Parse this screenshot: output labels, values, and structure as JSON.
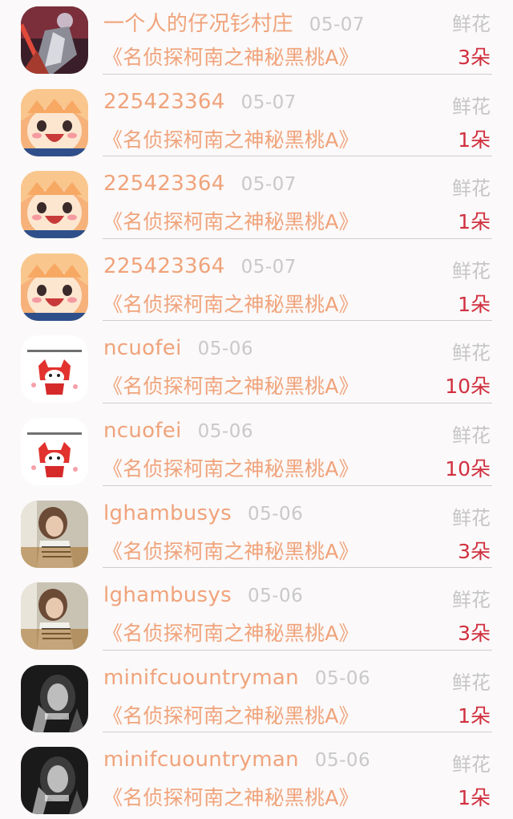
{
  "rows": [
    {
      "username": "一个人的仔况钐村庄",
      "date": "05-07",
      "book": "《名侦探柯南之神秘黑桃A》",
      "gift_type": "鲜花",
      "gift_count": "3朵",
      "avatar": "warrior"
    },
    {
      "username": "225423364",
      "date": "05-07",
      "book": "《名侦探柯南之神秘黑桃A》",
      "gift_type": "鲜花",
      "gift_count": "1朵",
      "avatar": "umaru"
    },
    {
      "username": "225423364",
      "date": "05-07",
      "book": "《名侦探柯南之神秘黑桃A》",
      "gift_type": "鲜花",
      "gift_count": "1朵",
      "avatar": "umaru"
    },
    {
      "username": "225423364",
      "date": "05-07",
      "book": "《名侦探柯南之神秘黑桃A》",
      "gift_type": "鲜花",
      "gift_count": "1朵",
      "avatar": "umaru"
    },
    {
      "username": "ncuofei",
      "date": "05-06",
      "book": "《名侦探柯南之神秘黑桃A》",
      "gift_type": "鲜花",
      "gift_count": "10朵",
      "avatar": "fox"
    },
    {
      "username": "ncuofei",
      "date": "05-06",
      "book": "《名侦探柯南之神秘黑桃A》",
      "gift_type": "鲜花",
      "gift_count": "10朵",
      "avatar": "fox"
    },
    {
      "username": "lghambusys",
      "date": "05-06",
      "book": "《名侦探柯南之神秘黑桃A》",
      "gift_type": "鲜花",
      "gift_count": "3朵",
      "avatar": "girl-photo"
    },
    {
      "username": "lghambusys",
      "date": "05-06",
      "book": "《名侦探柯南之神秘黑桃A》",
      "gift_type": "鲜花",
      "gift_count": "3朵",
      "avatar": "girl-photo"
    },
    {
      "username": "minifcuountryman",
      "date": "05-06",
      "book": "《名侦探柯南之神秘黑桃A》",
      "gift_type": "鲜花",
      "gift_count": "1朵",
      "avatar": "bw-portrait"
    },
    {
      "username": "minifcuountryman",
      "date": "05-06",
      "book": "《名侦探柯南之神秘黑桃A》",
      "gift_type": "鲜花",
      "gift_count": "1朵",
      "avatar": "bw-portrait"
    }
  ],
  "colors": {
    "username": "#f0a37b",
    "book": "#f0a37b",
    "date": "#c9c9c9",
    "gift_type": "#c6c6c6",
    "gift_count": "#d12f3f",
    "divider": "#cfcfcf",
    "background": "#fbf9f9"
  }
}
